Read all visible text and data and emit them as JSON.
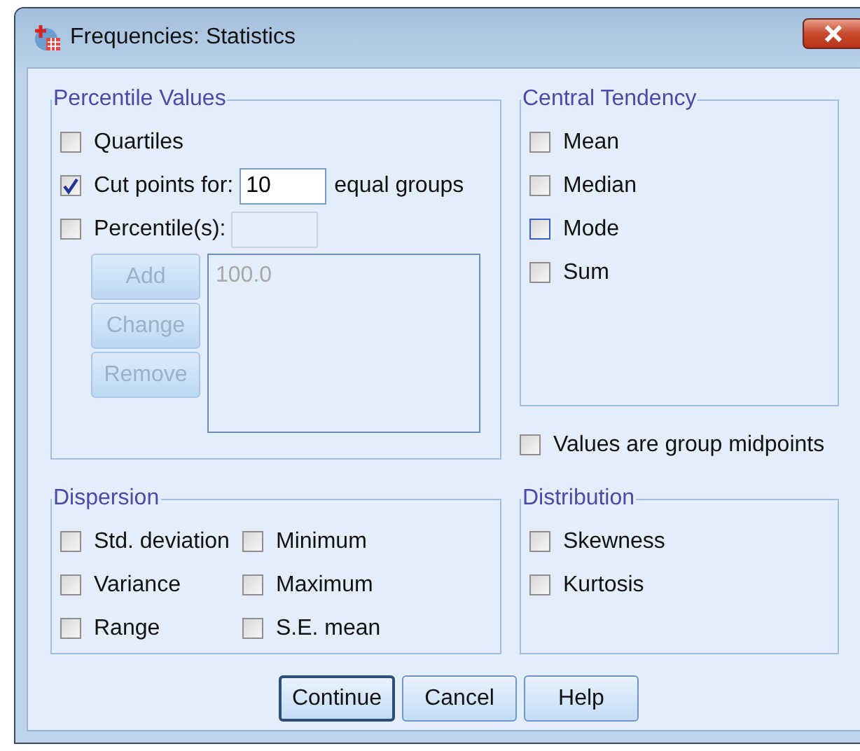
{
  "window": {
    "title": "Frequencies: Statistics"
  },
  "percentile_values": {
    "title": "Percentile Values",
    "quartiles": {
      "label": "Quartiles",
      "checked": false
    },
    "cut_points": {
      "label": "Cut points for:",
      "checked": true,
      "value": "10",
      "suffix": "equal groups"
    },
    "percentiles": {
      "label": "Percentile(s):",
      "checked": false,
      "field_disabled": true
    },
    "buttons": [
      {
        "label": "Add",
        "disabled": true
      },
      {
        "label": "Change",
        "disabled": true
      },
      {
        "label": "Remove",
        "disabled": true
      }
    ],
    "list": {
      "items": [
        "100.0"
      ],
      "disabled": true
    }
  },
  "central_tendency": {
    "title": "Central Tendency",
    "items": [
      {
        "label": "Mean",
        "checked": false,
        "focused": false
      },
      {
        "label": "Median",
        "checked": false,
        "focused": false
      },
      {
        "label": "Mode",
        "checked": false,
        "focused": true
      },
      {
        "label": "Sum",
        "checked": false,
        "focused": false
      }
    ]
  },
  "group_midpoints": {
    "label": "Values are group midpoints",
    "checked": false
  },
  "dispersion": {
    "title": "Dispersion",
    "items": [
      {
        "label": "Std. deviation",
        "checked": false
      },
      {
        "label": "Minimum",
        "checked": false
      },
      {
        "label": "Variance",
        "checked": false
      },
      {
        "label": "Maximum",
        "checked": false
      },
      {
        "label": "Range",
        "checked": false
      },
      {
        "label": "S.E. mean",
        "checked": false
      }
    ]
  },
  "distribution": {
    "title": "Distribution",
    "items": [
      {
        "label": "Skewness",
        "checked": false
      },
      {
        "label": "Kurtosis",
        "checked": false
      }
    ]
  },
  "buttons": [
    {
      "label": "Continue",
      "default": true
    },
    {
      "label": "Cancel",
      "default": false
    },
    {
      "label": "Help",
      "default": false
    }
  ]
}
